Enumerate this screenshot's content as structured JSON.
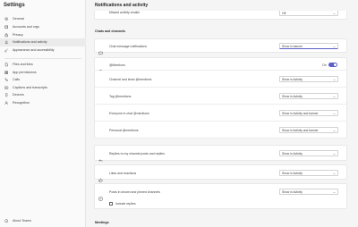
{
  "sidebar": {
    "title": "Settings",
    "items": [
      {
        "label": "General",
        "icon": "gear-icon"
      },
      {
        "label": "Accounts and orgs",
        "icon": "org-icon"
      },
      {
        "label": "Privacy",
        "icon": "lock-icon"
      },
      {
        "label": "Notifications and activity",
        "icon": "bell-icon",
        "active": true
      },
      {
        "label": "Appearance and accessibility",
        "icon": "brush-icon"
      }
    ],
    "items2": [
      {
        "label": "Files and links",
        "icon": "file-icon"
      },
      {
        "label": "App permissions",
        "icon": "grid-icon"
      },
      {
        "label": "Calls",
        "icon": "phone-icon"
      },
      {
        "label": "Captions and transcripts",
        "icon": "cc-icon"
      },
      {
        "label": "Devices",
        "icon": "device-icon"
      },
      {
        "label": "Recognition",
        "icon": "person-icon"
      }
    ],
    "about": "About Teams"
  },
  "main": {
    "title": "Notifications and activity",
    "missed": {
      "label": "Missed activity emails",
      "value": "Off"
    },
    "chats_heading": "Chats and channels",
    "chat_msg": {
      "label": "Chat message notifications",
      "value": "Show in banner"
    },
    "mentions": {
      "label": "@Mentions",
      "toggle_label": "On",
      "rows": [
        {
          "label": "Channel and team @mentions",
          "value": "Show in Activity"
        },
        {
          "label": "Tag @mentions",
          "value": "Show in Activity"
        },
        {
          "label": "Everyone in chat @mentions",
          "value": "Show in Activity and banner"
        },
        {
          "label": "Personal @mentions",
          "value": "Show in Activity and banner"
        }
      ]
    },
    "replies": {
      "label": "Replies to my channel posts and replies",
      "value": "Show in Activity"
    },
    "likes": {
      "label": "Likes and reactions",
      "value": "Show in Activity"
    },
    "posts": {
      "label": "Posts in shown and pinned channels",
      "value": "Show in Activity",
      "include_replies": "Include replies"
    },
    "meetings_heading": "Meetings"
  },
  "colors": {
    "accent": "#5b5fc7"
  }
}
